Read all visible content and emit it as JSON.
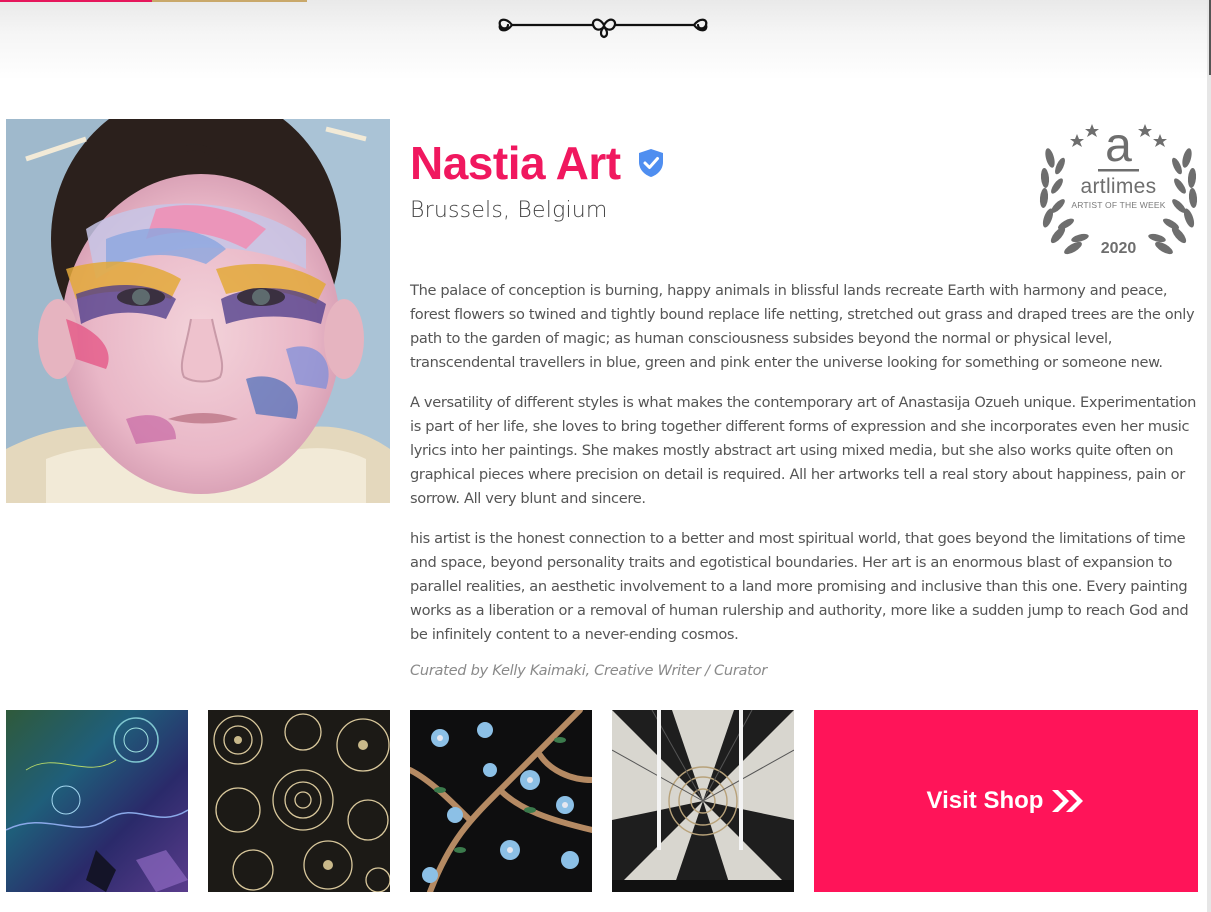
{
  "artist": {
    "name": "Nastia Art",
    "location": "Brussels, Belgium",
    "verified_icon": "verified-shield-check",
    "name_color": "#f0185f"
  },
  "award": {
    "brand": "artlimes",
    "subtitle": "ARTIST OF THE WEEK",
    "year": "2020",
    "letter": "a"
  },
  "bio": {
    "paragraphs": [
      "The palace of conception is burning, happy animals in blissful lands recreate Earth with harmony and peace, forest flowers so twined and tightly bound replace life netting, stretched out grass and draped trees are the only path to the garden of magic; as human consciousness subsides beyond the normal or physical level, transcendental travellers in blue, green and pink enter the universe looking for something or someone new.",
      "A versatility of different styles is what makes the contemporary art of Anastasija Ozueh unique. Experimentation is part of her life, she loves to bring together different forms of expression and she incorporates even her music lyrics into her paintings. She makes mostly abstract art using mixed media, but she also works quite often on graphical pieces where precision on detail is required. All her artworks tell a real story about happiness, pain or sorrow. All very blunt and sincere.",
      "his artist is the honest connection to a better and most spiritual world, that goes beyond the limitations of time and space, beyond personality traits and egotistical boundaries. Her art is an enormous blast of expansion to parallel realities, an aesthetic involvement to a land more promising and inclusive than this one. Every painting works as a liberation or a removal of human rulership and authority, more like a sudden jump to reach God and be infinitely content to a never-ending cosmos."
    ],
    "curator": "Curated by Kelly Kaimaki, Creative Writer / Curator"
  },
  "artworks": [
    {
      "name": "artwork-1"
    },
    {
      "name": "artwork-2"
    },
    {
      "name": "artwork-3"
    },
    {
      "name": "artwork-4"
    }
  ],
  "shop": {
    "label": "Visit Shop",
    "icon": "double-chevron-right-icon",
    "color": "#ff1459"
  },
  "colors": {
    "accent": "#f0185f",
    "text": "#555555",
    "award_gray": "#6e6e6e"
  }
}
